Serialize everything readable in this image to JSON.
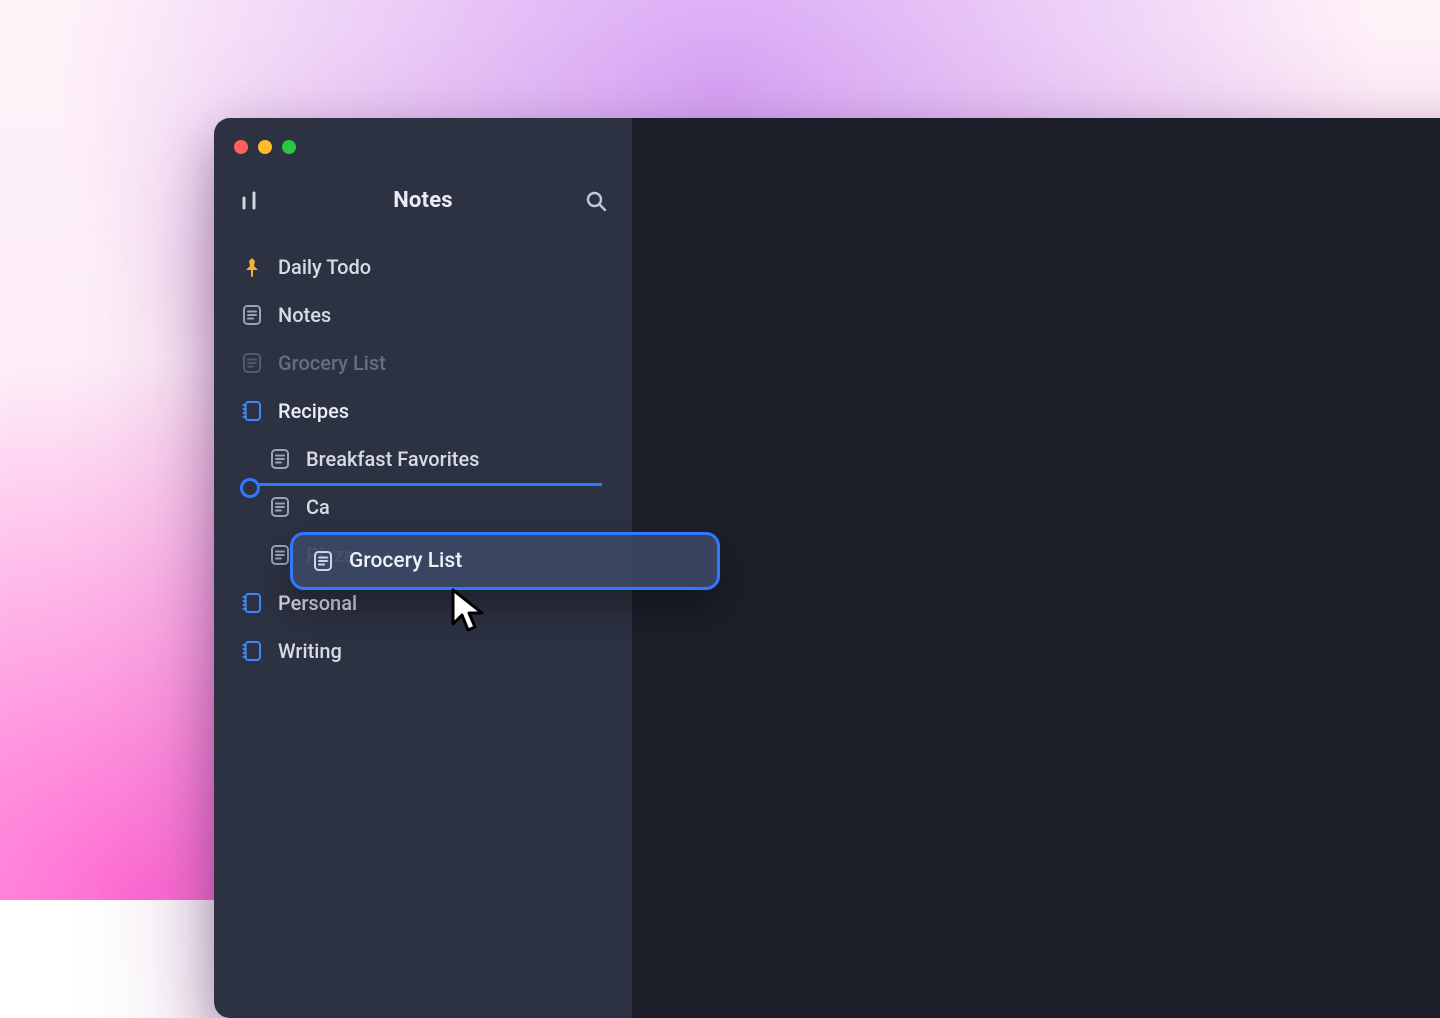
{
  "header": {
    "title": "Notes",
    "brand_icon": "lines-icon",
    "search_icon": "search-icon"
  },
  "sidebar": {
    "items": [
      {
        "icon": "pin",
        "label": "Daily Todo",
        "kind": "note",
        "indent": 0,
        "state": "normal"
      },
      {
        "icon": "note",
        "label": "Notes",
        "kind": "note",
        "indent": 0,
        "state": "normal"
      },
      {
        "icon": "note",
        "label": "Grocery List",
        "kind": "note",
        "indent": 0,
        "state": "ghost"
      },
      {
        "icon": "notebook",
        "label": "Recipes",
        "kind": "notebook",
        "indent": 0,
        "state": "active"
      },
      {
        "icon": "note",
        "label": "Breakfast Favorites",
        "kind": "note",
        "indent": 1,
        "state": "normal"
      },
      {
        "icon": "note",
        "label": "Ca",
        "kind": "note",
        "indent": 1,
        "state": "normal"
      },
      {
        "icon": "note",
        "label": "Pizza",
        "kind": "note",
        "indent": 1,
        "state": "normal"
      },
      {
        "icon": "notebook",
        "label": "Personal",
        "kind": "notebook",
        "indent": 0,
        "state": "normal"
      },
      {
        "icon": "notebook",
        "label": "Writing",
        "kind": "notebook",
        "indent": 0,
        "state": "normal"
      }
    ],
    "drop_after_index": 4
  },
  "drag": {
    "label": "Grocery List",
    "icon": "note"
  },
  "colors": {
    "accent": "#2f78ff",
    "sidebar_bg": "#2d3243",
    "content_bg": "#1c1f2a"
  }
}
